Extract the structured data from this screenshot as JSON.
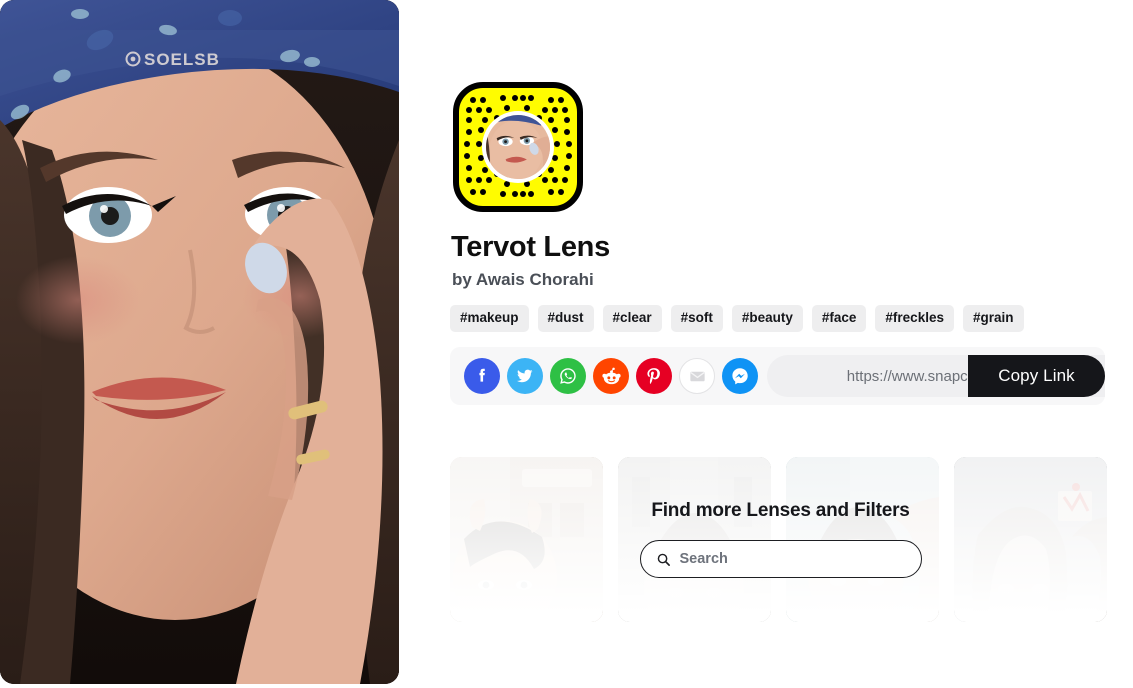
{
  "hero": {
    "alt": "portrait-photo-woman-blue-bandana",
    "watermark": "@SOELSB"
  },
  "lens": {
    "title": "Tervot Lens",
    "author": "by Awais Chorahi",
    "snapcode_alt": "snapcode-yellow-with-portrait"
  },
  "tags": [
    {
      "label": "#makeup"
    },
    {
      "label": "#dust"
    },
    {
      "label": "#clear"
    },
    {
      "label": "#soft"
    },
    {
      "label": "#beauty"
    },
    {
      "label": "#face"
    },
    {
      "label": "#freckles"
    },
    {
      "label": "#grain"
    }
  ],
  "share": {
    "socials": [
      {
        "name": "facebook",
        "color": "#3a5bea"
      },
      {
        "name": "twitter",
        "color": "#3cb4f5"
      },
      {
        "name": "whatsapp",
        "color": "#2ec045"
      },
      {
        "name": "reddit",
        "color": "#ff4500"
      },
      {
        "name": "pinterest",
        "color": "#e60023"
      },
      {
        "name": "email",
        "color": "#ffffff"
      },
      {
        "name": "messenger",
        "color": "#0f93f5"
      }
    ],
    "url_value": "https://www.snapchat....",
    "copy_label": "Copy Link"
  },
  "discover": {
    "title": "Find more Lenses and Filters",
    "search_placeholder": "Search",
    "thumbnails": [
      {
        "alt": "lens-thumbnail-1"
      },
      {
        "alt": "lens-thumbnail-2"
      },
      {
        "alt": "lens-thumbnail-3"
      },
      {
        "alt": "lens-thumbnail-4"
      }
    ]
  },
  "colors": {
    "snap_yellow": "#FFFC00",
    "black": "#15161a",
    "tag_bg": "#eeeeef",
    "share_bg": "#f7f7f8"
  }
}
